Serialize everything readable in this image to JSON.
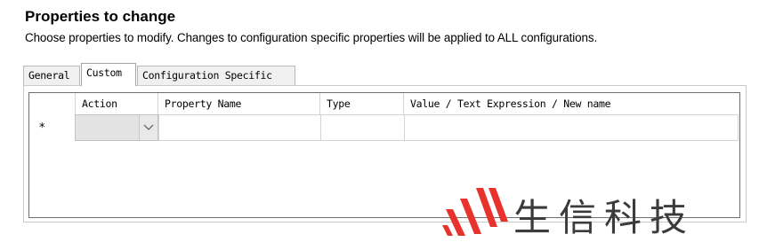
{
  "header": {
    "title": "Properties to change",
    "subtitle": "Choose properties to modify.  Changes to configuration specific properties will be applied to ALL configurations."
  },
  "tabs": [
    {
      "label": "General",
      "active": false
    },
    {
      "label": "Custom",
      "active": true
    },
    {
      "label": "Configuration Specific",
      "active": false
    }
  ],
  "grid": {
    "columns": [
      "Action",
      "Property Name",
      "Type",
      "Value / Text Expression / New name"
    ],
    "new_row_marker": "*",
    "new_row": {
      "action": "",
      "property_name": "",
      "type": "",
      "value": ""
    }
  },
  "watermark": {
    "text": "生信科技",
    "colors": {
      "mark": "#e8322c",
      "text": "#3b3b3b"
    }
  }
}
